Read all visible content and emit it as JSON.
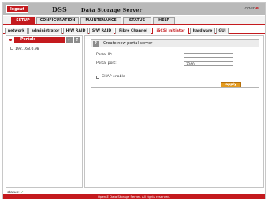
{
  "app": {
    "logout_label": "logout",
    "brand_short": "DSS",
    "brand_long": "Data Storage Server",
    "logo_prefix": "open",
    "logo_suffix": "e"
  },
  "main_tabs": [
    {
      "label": "SETUP"
    },
    {
      "label": "CONFIGURATION"
    },
    {
      "label": "MAINTENANCE"
    },
    {
      "label": "STATUS"
    },
    {
      "label": "HELP"
    }
  ],
  "sub_tabs": [
    {
      "label": "network"
    },
    {
      "label": "administrator"
    },
    {
      "label": "H/W RAID"
    },
    {
      "label": "S/W RAID"
    },
    {
      "label": "Fibre Channel"
    },
    {
      "label": "iSCSI Initiator"
    },
    {
      "label": "hardware"
    },
    {
      "label": "GUI"
    }
  ],
  "sidebar": {
    "title": "Portals",
    "check_glyph": "✓",
    "help_glyph": "?",
    "items": [
      {
        "label": "192.168.0.98"
      }
    ]
  },
  "status": {
    "label": "status:",
    "glyph": "✓"
  },
  "panel": {
    "help_glyph": "?",
    "title": "Create new portal server",
    "portal_ip_label": "Portal IP:",
    "portal_ip_value": "",
    "portal_port_label": "Portal port:",
    "portal_port_value": "3260",
    "chap_label": "CHAP enable",
    "apply_label": "apply"
  },
  "footer": {
    "text": "Open-E Data Storage Server. All rights reserved."
  },
  "colors": {
    "accent": "#c41a1e",
    "button": "#e39a1e"
  }
}
